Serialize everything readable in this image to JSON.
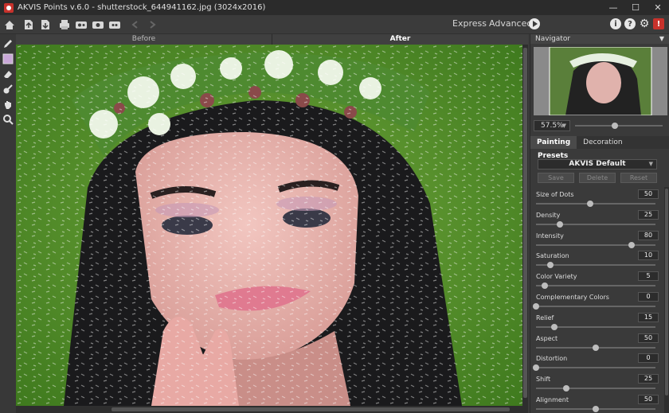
{
  "window": {
    "title": "AKVIS Points v.6.0 - shutterstock_644941162.jpg (3024x2016)",
    "minimize": "—",
    "maximize": "☐",
    "close": "✕"
  },
  "toolbar": {
    "icons": [
      "home-icon",
      "open-icon",
      "save-icon",
      "print-icon",
      "share-icon",
      "settings-batch-icon",
      "plugin-icon",
      "undo-icon",
      "redo-icon"
    ],
    "express_label": "Express",
    "advanced_label": "Advanced",
    "info_label": "i",
    "help_label": "?",
    "prefs_label": "⚙",
    "bookmark_label": "!"
  },
  "left_tools": [
    "pencil-tool-icon",
    "color-swatch-icon",
    "eraser-icon",
    "dropper-icon",
    "hand-icon",
    "zoom-icon"
  ],
  "canvas_tabs": {
    "before": "Before",
    "after": "After"
  },
  "navigator": {
    "title": "Navigator",
    "zoom_value": "57.5%",
    "zoom_level": 0.45
  },
  "panel_tabs": {
    "painting": "Painting",
    "decoration": "Decoration"
  },
  "presets": {
    "label": "Presets",
    "selected": "AKVIS Default",
    "save": "Save",
    "delete": "Delete",
    "reset": "Reset"
  },
  "params": [
    {
      "label": "Size of Dots",
      "value": "50",
      "level": 0.45
    },
    {
      "label": "Density",
      "value": "25",
      "level": 0.2
    },
    {
      "label": "Intensity",
      "value": "80",
      "level": 0.8
    },
    {
      "label": "Saturation",
      "value": "10",
      "level": 0.12
    },
    {
      "label": "Color Variety",
      "value": "5",
      "level": 0.07
    },
    {
      "label": "Complementary Colors",
      "value": "0",
      "level": 0.0
    },
    {
      "label": "Relief",
      "value": "15",
      "level": 0.15
    },
    {
      "label": "Aspect",
      "value": "50",
      "level": 0.5
    },
    {
      "label": "Distortion",
      "value": "0",
      "level": 0.0
    },
    {
      "label": "Shift",
      "value": "25",
      "level": 0.25
    },
    {
      "label": "Alignment",
      "value": "50",
      "level": 0.5
    }
  ]
}
